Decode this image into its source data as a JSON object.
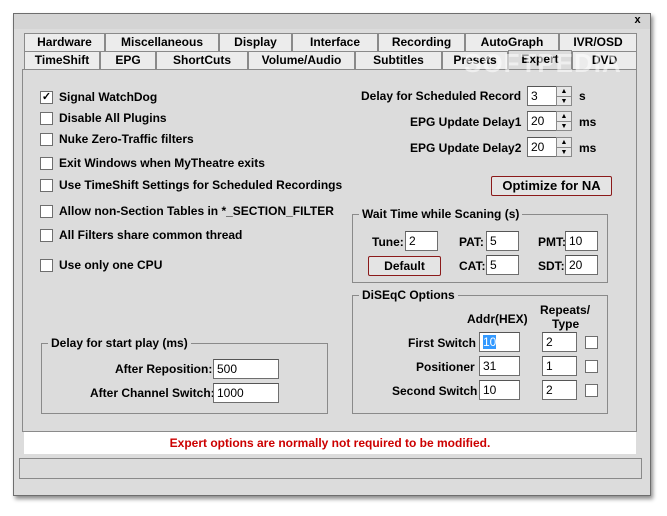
{
  "window": {
    "close_glyph": "x"
  },
  "tabs_row1": [
    "Hardware",
    "Miscellaneous",
    "Display",
    "Interface",
    "Recording",
    "AutoGraph",
    "IVR/OSD"
  ],
  "tabs_row2": [
    "TimeShift",
    "EPG",
    "ShortCuts",
    "Volume/Audio",
    "Subtitles",
    "Presets",
    "Expert",
    "DVD"
  ],
  "active_tab": "Expert",
  "watermark": "SOFTPEDIA",
  "checkboxes": [
    {
      "label": "Signal WatchDog",
      "checked": true
    },
    {
      "label": "Disable All Plugins",
      "checked": false
    },
    {
      "label": "Nuke Zero-Traffic filters",
      "checked": false
    },
    {
      "label": "Exit Windows when MyTheatre exits",
      "checked": false
    },
    {
      "label": "Use TimeShift Settings for Scheduled Recordings",
      "checked": false
    },
    {
      "label": "Allow non-Section Tables in *_SECTION_FILTER",
      "checked": false
    },
    {
      "label": "All Filters share common thread",
      "checked": false
    },
    {
      "label": "Use only one CPU",
      "checked": false
    }
  ],
  "delays": {
    "scheduled_record": {
      "label": "Delay for Scheduled Record",
      "value": "3",
      "unit": "s"
    },
    "epg1": {
      "label": "EPG Update Delay1",
      "value": "20",
      "unit": "ms"
    },
    "epg2": {
      "label": "EPG Update Delay2",
      "value": "20",
      "unit": "ms"
    }
  },
  "optimize_label": "Optimize for NA",
  "wait_time": {
    "title": "Wait Time while Scaning (s)",
    "tune_label": "Tune:",
    "tune_value": "2",
    "pat_label": "PAT:",
    "pat_value": "5",
    "pmt_label": "PMT:",
    "pmt_value": "10",
    "cat_label": "CAT:",
    "cat_value": "5",
    "sdt_label": "SDT:",
    "sdt_value": "20",
    "default_label": "Default"
  },
  "diseqc": {
    "title": "DiSEqC Options",
    "addr_header": "Addr(HEX)",
    "repeats_header_line1": "Repeats/",
    "repeats_header_line2": "Type",
    "rows": [
      {
        "label": "First Switch",
        "addr": "10",
        "repeats": "2"
      },
      {
        "label": "Positioner",
        "addr": "31",
        "repeats": "1"
      },
      {
        "label": "Second Switch",
        "addr": "10",
        "repeats": "2"
      }
    ]
  },
  "start_play": {
    "title": "Delay for start play  (ms)",
    "reposition_label": "After Reposition:",
    "reposition_value": "500",
    "channel_switch_label": "After Channel Switch:",
    "channel_switch_value": "1000"
  },
  "status_message": "Expert options are normally not required to be modified.",
  "colors": {
    "status_text": "#cc0000",
    "button_border": "#8b1a1a",
    "selection": "#3399ff"
  }
}
